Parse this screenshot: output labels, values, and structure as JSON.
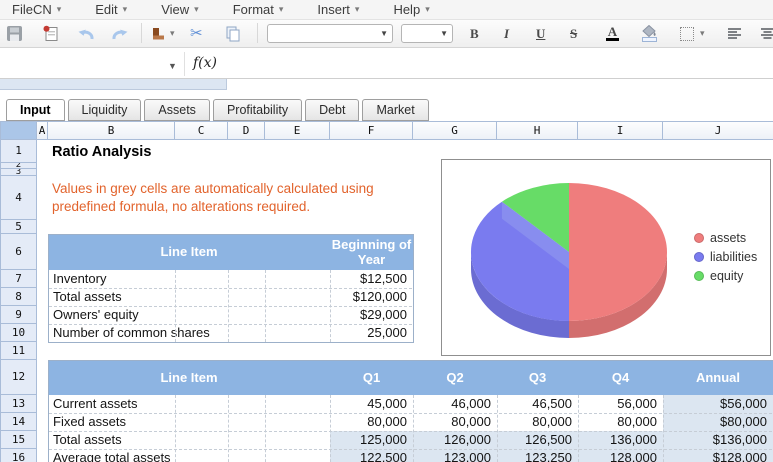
{
  "menu_bar": {
    "items": [
      "FileCN",
      "Edit",
      "View",
      "Format",
      "Insert",
      "Help"
    ]
  },
  "toolbar": {
    "icons": [
      "save-icon",
      "print-icon",
      "undo-icon",
      "redo-icon",
      "paint-format-icon",
      "cut-icon",
      "copy-icon",
      "font-select",
      "font-size-select",
      "bold-button",
      "italic-button",
      "underline-button",
      "strikethrough-button",
      "text-color-button",
      "fill-color-button",
      "borders-button",
      "align-left-button",
      "align-center-button"
    ],
    "labels": {
      "bold": "B",
      "italic": "I",
      "underline": "U",
      "strikethrough": "S",
      "text_color": "A"
    },
    "font_name_value": "",
    "font_size_value": ""
  },
  "formula_bar": {
    "name_box_value": "",
    "fx_label": "f(x)",
    "formula_value": ""
  },
  "sheet_tabs": {
    "active": "Input",
    "tabs": [
      "Input",
      "Liquidity",
      "Assets",
      "Profitability",
      "Debt",
      "Market"
    ]
  },
  "grid": {
    "column_headers": [
      "A",
      "B",
      "C",
      "D",
      "E",
      "F",
      "G",
      "H",
      "I",
      "J"
    ],
    "row_headers": [
      "1",
      "2",
      "3",
      "4",
      "5",
      "6",
      "7",
      "8",
      "9",
      "10",
      "11",
      "12",
      "13",
      "14",
      "15",
      "16"
    ]
  },
  "content": {
    "title": "Ratio Analysis",
    "note_line1": "Values in grey cells are automatically calculated using",
    "note_line2": "predefined formula, no alterations required.",
    "table1": {
      "header": [
        "Line Item",
        "Beginning of Year"
      ],
      "rows": [
        {
          "label": "Inventory",
          "value": "$12,500"
        },
        {
          "label": "Total assets",
          "value": "$120,000"
        },
        {
          "label": "Owners' equity",
          "value": "$29,000"
        },
        {
          "label": "Number of common shares",
          "value": "25,000"
        }
      ]
    },
    "table2": {
      "header": [
        "Line Item",
        "Q1",
        "Q2",
        "Q3",
        "Q4",
        "Annual"
      ],
      "rows": [
        {
          "label": "Current assets",
          "values": [
            "45,000",
            "46,000",
            "46,500",
            "56,000",
            "$56,000"
          ],
          "grey": [
            false,
            false,
            false,
            false,
            true
          ]
        },
        {
          "label": "Fixed assets",
          "values": [
            "80,000",
            "80,000",
            "80,000",
            "80,000",
            "$80,000"
          ],
          "grey": [
            false,
            false,
            false,
            false,
            true
          ]
        },
        {
          "label": "Total assets",
          "values": [
            "125,000",
            "126,000",
            "126,500",
            "136,000",
            "$136,000"
          ],
          "grey": [
            true,
            true,
            true,
            true,
            true
          ]
        },
        {
          "label": "Average total assets",
          "values": [
            "122,500",
            "123,000",
            "123,250",
            "128,000",
            "$128,000"
          ],
          "grey": [
            true,
            true,
            true,
            true,
            true
          ]
        }
      ]
    }
  },
  "chart_data": {
    "type": "pie",
    "effect": "3d",
    "labels": [
      "assets",
      "liabilities",
      "equity"
    ],
    "values": [
      50,
      38,
      12
    ],
    "colors": [
      "#ef7d7d",
      "#7a7bef",
      "#67dc67"
    ],
    "legend_position": "right",
    "title": ""
  },
  "colors": {
    "table_header_bg": "#8db4e2",
    "calc_cell_bg": "#dce6f1",
    "note_text": "#e2632c"
  }
}
